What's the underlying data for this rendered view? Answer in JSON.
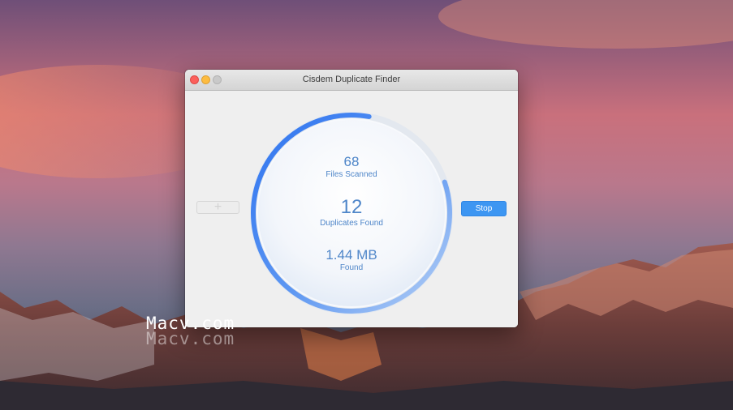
{
  "window": {
    "title": "Cisdem Duplicate Finder"
  },
  "toolbar": {
    "add_label": "+",
    "stop_label": "Stop"
  },
  "progress": {
    "fraction": 0.83,
    "accent": "#3b7ff5"
  },
  "stats": {
    "files_scanned": {
      "value": "68",
      "label": "Files Scanned"
    },
    "duplicates_found": {
      "value": "12",
      "label": "Duplicates Found"
    },
    "size_found": {
      "value": "1.44 MB",
      "label": "Found"
    }
  },
  "watermark": "Macv.com",
  "colors": {
    "stop_button": "#3d96f2",
    "stat_text": "#4f86c9"
  }
}
